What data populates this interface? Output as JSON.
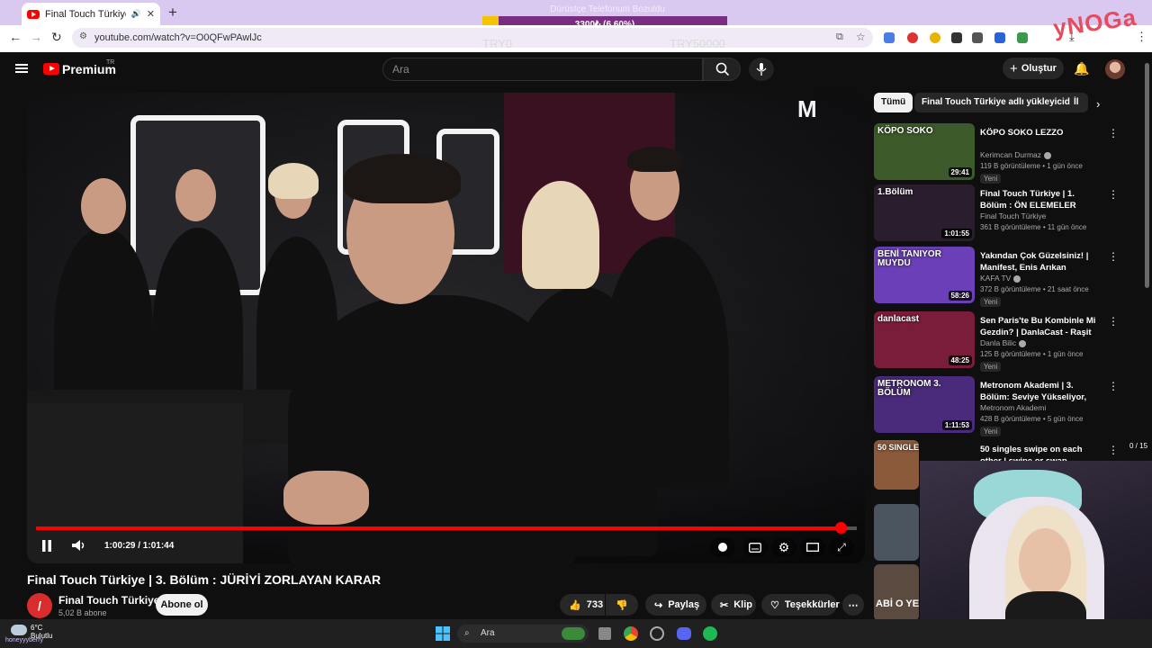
{
  "browser": {
    "tab_title": "Final Touch Türkiye | 3. Bölü",
    "url": "youtube.com/watch?v=O0QFwPAwlJc"
  },
  "donation": {
    "title": "Dürüstçe Telefonum Bozuldu",
    "progress_text": "3300₺ (6.60%)",
    "progress_fraction": 0.066,
    "min_label": "TRY0",
    "max_label": "TRY50000"
  },
  "brand_overlay": "yNOGa",
  "youtube": {
    "logo_text": "Premium",
    "region": "TR",
    "search_placeholder": "Ara",
    "create_label": "Oluştur"
  },
  "player": {
    "time": "1:00:29 / 1:01:44",
    "progress_fraction": 0.98,
    "watermark": "M"
  },
  "video": {
    "title": "Final Touch Türkiye | 3. Bölüm : JÜRİYİ ZORLAYAN KARAR",
    "channel_initial": "/",
    "channel": "Final Touch Türkiye",
    "subscribers": "5,02 B abone",
    "subscribe_label": "Abone ol",
    "likes": "733",
    "share_label": "Paylaş",
    "clip_label": "Klip",
    "thanks_label": "Teşekkürler"
  },
  "sidebar": {
    "chips": [
      "Tümü",
      "Final Touch Türkiye adlı yükleyiciden",
      "İl"
    ],
    "items": [
      {
        "title": "KÖPO SOKO LEZZO",
        "channel": "Kerimcan Durmaz",
        "verified": true,
        "stats": "119 B görüntüleme • 1 gün önce",
        "badge": "Yeni",
        "duration": "29:41",
        "thumb_label": "KÖPO SOKO",
        "thumb_color": "#3c5a2a"
      },
      {
        "title": "Final Touch Türkiye | 1. Bölüm : ÖN ELEMELER BAŞLIYOR",
        "channel": "Final Touch Türkiye",
        "verified": false,
        "stats": "361 B görüntüleme • 11 gün önce",
        "badge": "",
        "duration": "1:01:55",
        "thumb_label": "1.Bölüm",
        "thumb_color": "#2a1e2e"
      },
      {
        "title": "Yakından Çok Güzelsiniz! | Manifest, Enis Arıkan",
        "channel": "KAFA TV",
        "verified": true,
        "stats": "372 B görüntüleme • 21 saat önce",
        "badge": "Yeni",
        "duration": "58:26",
        "thumb_label": "BENİ TANIYOR MUYDU",
        "thumb_color": "#6b3fb8"
      },
      {
        "title": "Sen Paris'te Bu Kombinle Mi Gezdin? | DanlaCast - Raşit ...",
        "channel": "Danla Bilic",
        "verified": true,
        "stats": "125 B görüntüleme • 1 gün önce",
        "badge": "Yeni",
        "duration": "48:25",
        "thumb_label": "danlacast",
        "thumb_color": "#7a1d3b"
      },
      {
        "title": "Metronom Akademi | 3. Bölüm: Seviye Yükseliyor, Sahne ...",
        "channel": "Metronom Akademi",
        "verified": false,
        "stats": "428 B görüntüleme • 5 gün önce",
        "badge": "Yeni",
        "duration": "1:11:53",
        "thumb_label": "METRONOM 3. BÖLÜM",
        "thumb_color": "#4a2a7a"
      },
      {
        "title": "50 singles swipe on each other | swipe or swap",
        "channel": "",
        "verified": false,
        "stats": "",
        "badge": "",
        "duration": "",
        "thumb_label": "50 SINGLES SWIPE IRL",
        "thumb_color": "#8a5a3a"
      }
    ],
    "extra_thumbs": [
      {
        "label": "",
        "color": "#4a5560"
      },
      {
        "label": "ABİ O YE",
        "color": "#5a4a40"
      }
    ]
  },
  "overlay_counter": "0 / 15",
  "taskbar": {
    "temperature": "6°C",
    "weather": "Bulutlu",
    "search_placeholder": "Ara",
    "username": "honeyyyberry"
  },
  "colors": {
    "yt_red": "#ff0000",
    "accent_purple": "#7a2e82",
    "progress_yellow": "#f4c400"
  }
}
